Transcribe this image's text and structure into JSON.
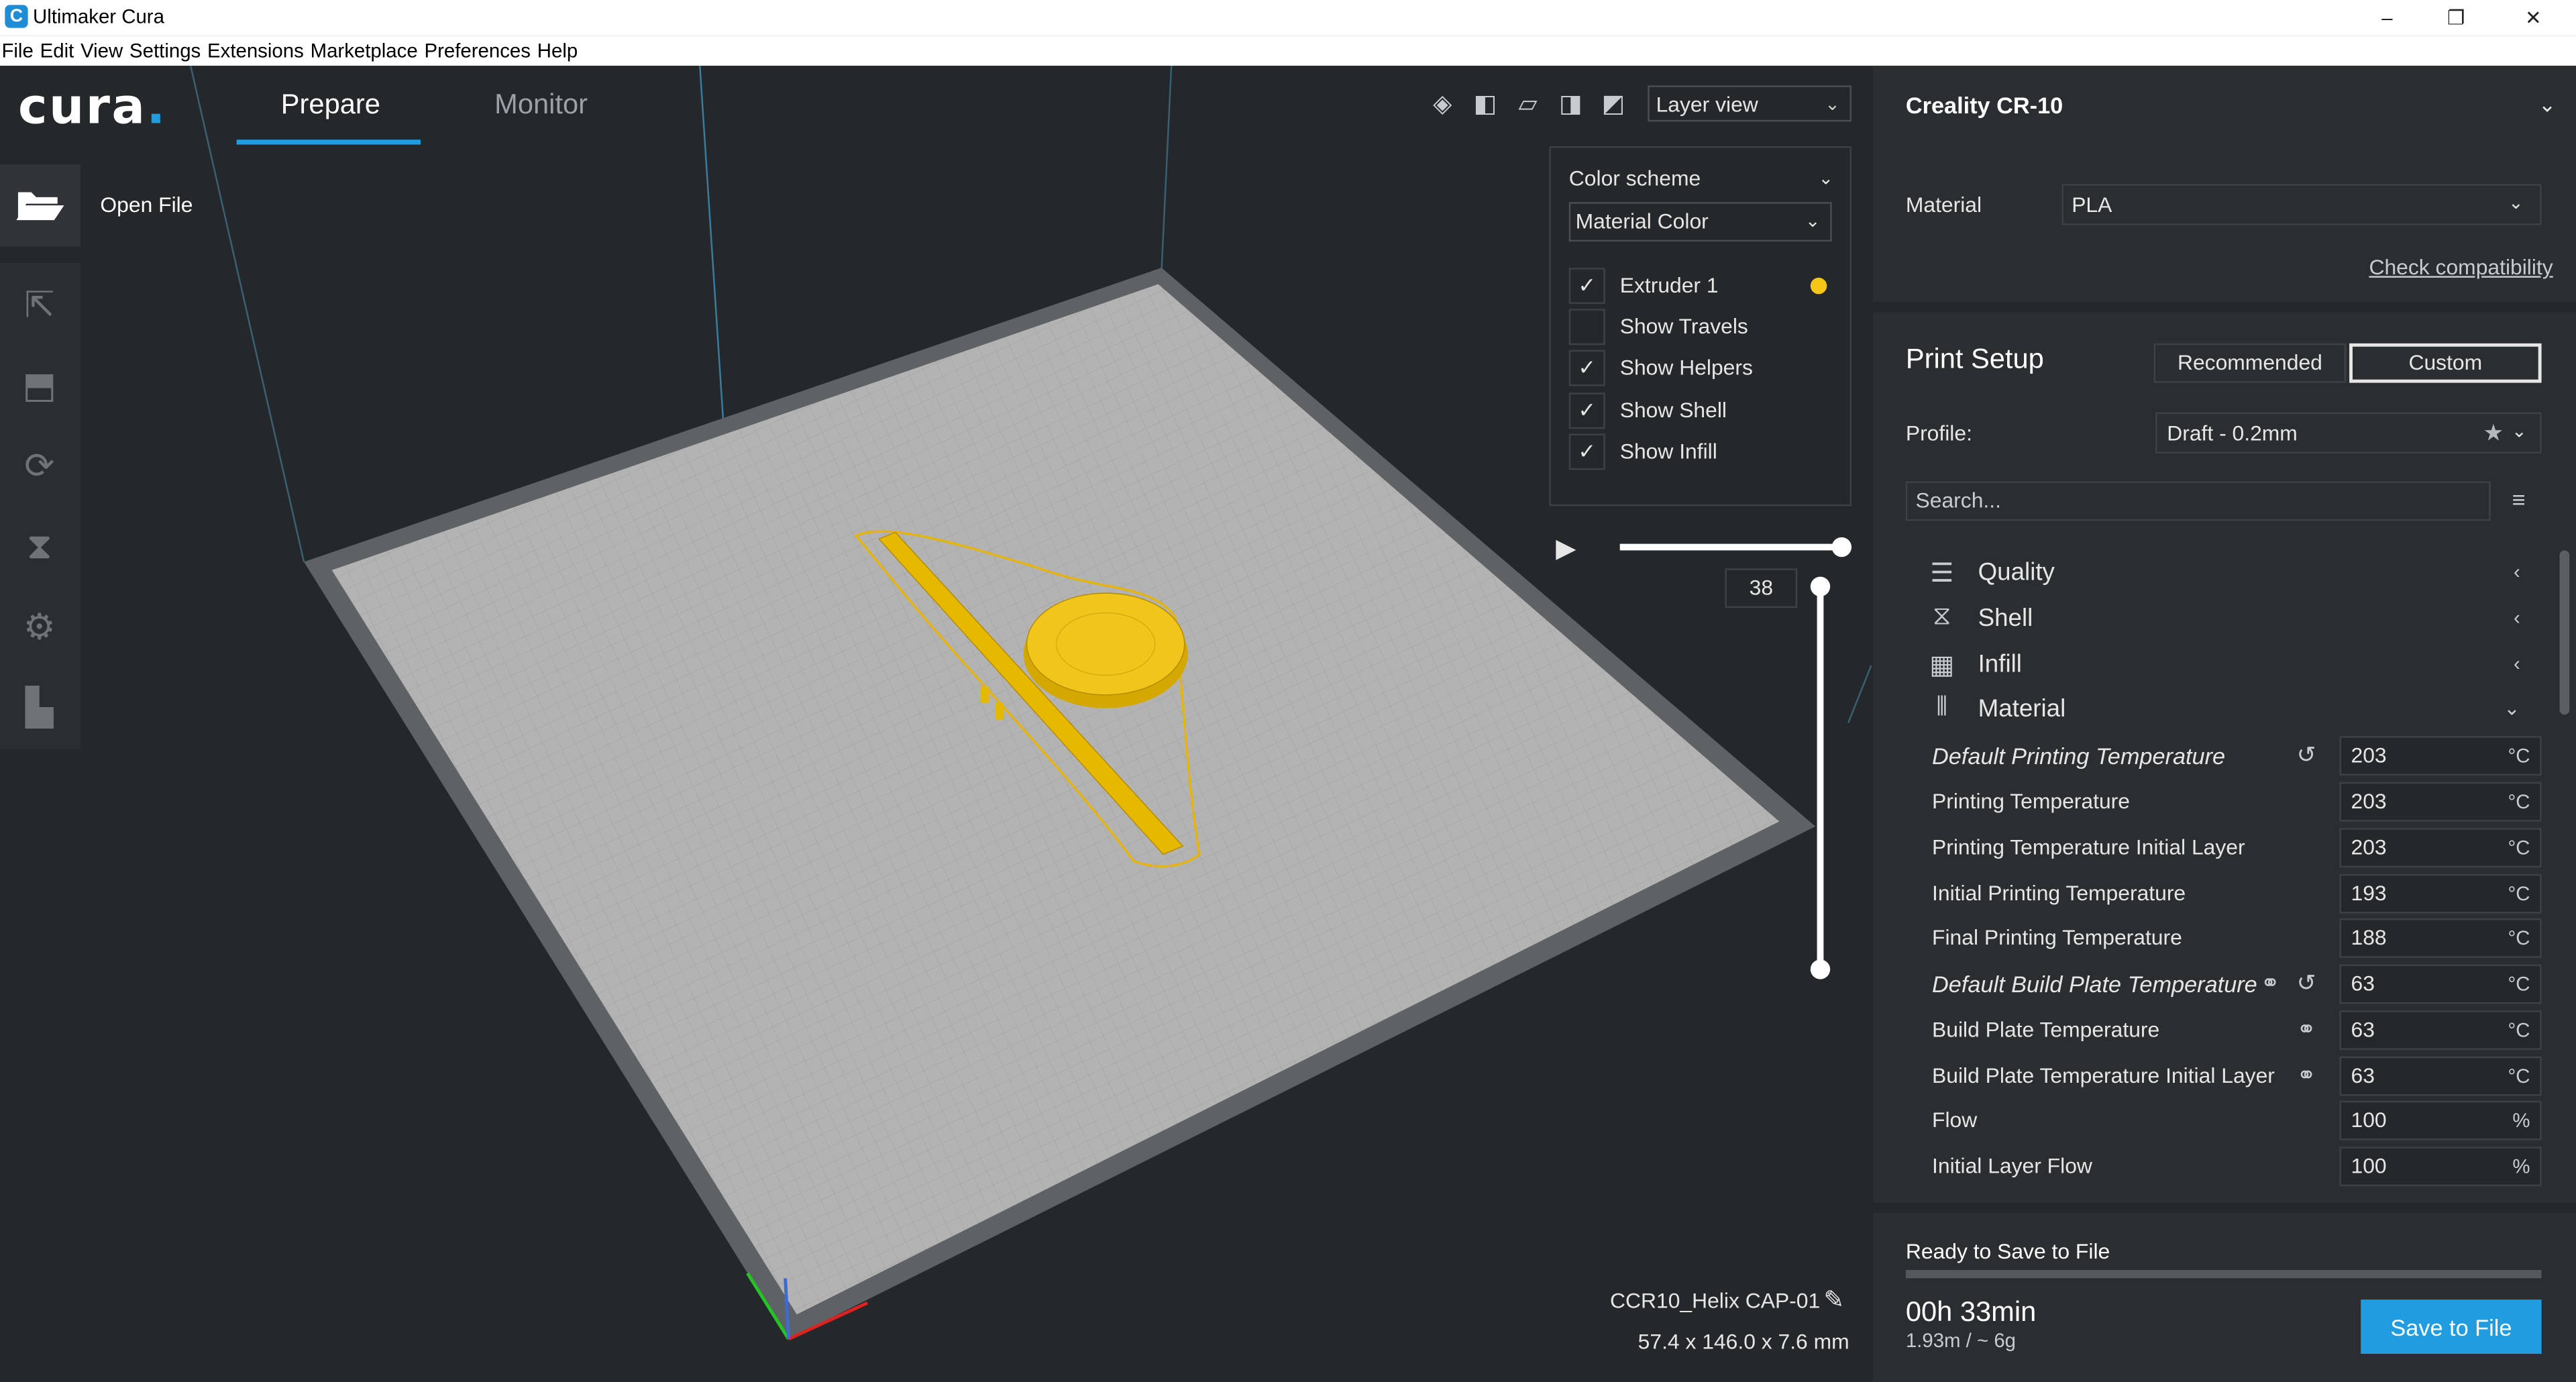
{
  "window": {
    "title": "Ultimaker Cura",
    "app_icon": "C",
    "controls": {
      "minimize": "–",
      "restore": "❐",
      "close": "✕"
    }
  },
  "menu": [
    "File",
    "Edit",
    "View",
    "Settings",
    "Extensions",
    "Marketplace",
    "Preferences",
    "Help"
  ],
  "logo": {
    "text": "cura",
    "dot": "."
  },
  "tabs": {
    "prepare": "Prepare",
    "monitor": "Monitor"
  },
  "view_select": {
    "value": "Layer view",
    "chevron": "⌄"
  },
  "left_tools": {
    "open_file_label": "Open File"
  },
  "layer_panel": {
    "color_scheme_label": "Color scheme",
    "color_scheme_value": "Material Color",
    "checkboxes": [
      {
        "label": "Extruder 1",
        "checked": true
      },
      {
        "label": "Show Travels",
        "checked": false
      },
      {
        "label": "Show Helpers",
        "checked": true
      },
      {
        "label": "Show Shell",
        "checked": true
      },
      {
        "label": "Show Infill",
        "checked": true
      }
    ],
    "extruder_color": "#f5c518",
    "current_layer": "38"
  },
  "model": {
    "name": "CCR10_Helix CAP-01",
    "dimensions": "57.4 x 146.0 x 7.6 mm"
  },
  "printer": {
    "name": "Creality CR-10"
  },
  "material": {
    "label": "Material",
    "value": "PLA",
    "check_link": "Check compatibility"
  },
  "print_setup": {
    "title": "Print Setup",
    "mode_recommended": "Recommended",
    "mode_custom": "Custom",
    "profile_label": "Profile:",
    "profile_value": "Draft - 0.2mm",
    "search_placeholder": "Search..."
  },
  "categories": [
    {
      "label": "Quality",
      "icon": "quality-icon",
      "expanded": false
    },
    {
      "label": "Shell",
      "icon": "shell-icon",
      "expanded": false
    },
    {
      "label": "Infill",
      "icon": "infill-icon",
      "expanded": false
    },
    {
      "label": "Material",
      "icon": "material-icon",
      "expanded": true
    }
  ],
  "material_settings": [
    {
      "label": "Default Printing Temperature",
      "value": "203",
      "unit": "°C",
      "italic": true,
      "reset": true,
      "link": false
    },
    {
      "label": "Printing Temperature",
      "value": "203",
      "unit": "°C",
      "italic": false,
      "reset": false,
      "link": false
    },
    {
      "label": "Printing Temperature Initial Layer",
      "value": "203",
      "unit": "°C",
      "italic": false,
      "reset": false,
      "link": false
    },
    {
      "label": "Initial Printing Temperature",
      "value": "193",
      "unit": "°C",
      "italic": false,
      "reset": false,
      "link": false
    },
    {
      "label": "Final Printing Temperature",
      "value": "188",
      "unit": "°C",
      "italic": false,
      "reset": false,
      "link": false
    },
    {
      "label": "Default Build Plate Temperature",
      "value": "63",
      "unit": "°C",
      "italic": true,
      "reset": true,
      "link": true
    },
    {
      "label": "Build Plate Temperature",
      "value": "63",
      "unit": "°C",
      "italic": false,
      "reset": false,
      "link": true
    },
    {
      "label": "Build Plate Temperature Initial Layer",
      "value": "63",
      "unit": "°C",
      "italic": false,
      "reset": false,
      "link": true
    },
    {
      "label": "Flow",
      "value": "100",
      "unit": "%",
      "italic": false,
      "reset": false,
      "link": false
    },
    {
      "label": "Initial Layer Flow",
      "value": "100",
      "unit": "%",
      "italic": false,
      "reset": false,
      "link": false
    }
  ],
  "output": {
    "status": "Ready to Save to File",
    "time": "00h 33min",
    "material_estimate": "1.93m / ~ 6g",
    "save_button": "Save to File"
  },
  "colors": {
    "accent": "#1f9de0",
    "background": "#25282b",
    "panel": "#2b2e31",
    "print": "#f5c518"
  }
}
